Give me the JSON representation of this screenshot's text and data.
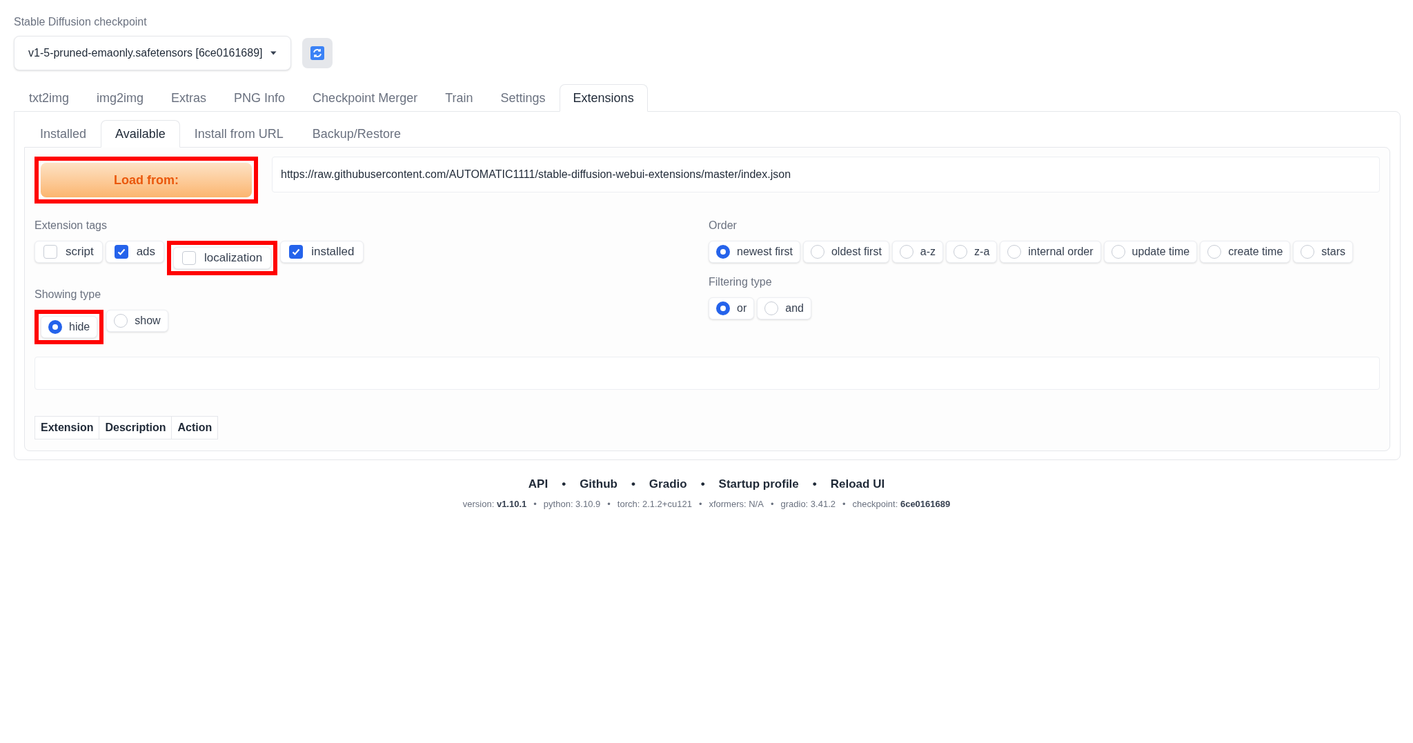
{
  "checkpoint": {
    "label": "Stable Diffusion checkpoint",
    "value": "v1-5-pruned-emaonly.safetensors [6ce0161689]"
  },
  "tabs": [
    {
      "label": "txt2img",
      "selected": false
    },
    {
      "label": "img2img",
      "selected": false
    },
    {
      "label": "Extras",
      "selected": false
    },
    {
      "label": "PNG Info",
      "selected": false
    },
    {
      "label": "Checkpoint Merger",
      "selected": false
    },
    {
      "label": "Train",
      "selected": false
    },
    {
      "label": "Settings",
      "selected": false
    },
    {
      "label": "Extensions",
      "selected": true
    }
  ],
  "subtabs": [
    {
      "label": "Installed",
      "selected": false
    },
    {
      "label": "Available",
      "selected": true
    },
    {
      "label": "Install from URL",
      "selected": false
    },
    {
      "label": "Backup/Restore",
      "selected": false
    }
  ],
  "load_button": {
    "label": "Load from:",
    "highlighted": true
  },
  "url_field": {
    "value": "https://raw.githubusercontent.com/AUTOMATIC1111/stable-diffusion-webui-extensions/master/index.json"
  },
  "extension_tags": {
    "label": "Extension tags",
    "items": [
      {
        "label": "script",
        "checked": false,
        "highlighted": false
      },
      {
        "label": "ads",
        "checked": true,
        "highlighted": false
      },
      {
        "label": "localization",
        "checked": false,
        "highlighted": true
      },
      {
        "label": "installed",
        "checked": true,
        "highlighted": false
      }
    ]
  },
  "order": {
    "label": "Order",
    "items": [
      {
        "label": "newest first",
        "selected": true
      },
      {
        "label": "oldest first",
        "selected": false
      },
      {
        "label": "a-z",
        "selected": false
      },
      {
        "label": "z-a",
        "selected": false
      },
      {
        "label": "internal order",
        "selected": false
      },
      {
        "label": "update time",
        "selected": false
      },
      {
        "label": "create time",
        "selected": false
      },
      {
        "label": "stars",
        "selected": false
      }
    ]
  },
  "showing_type": {
    "label": "Showing type",
    "items": [
      {
        "label": "hide",
        "selected": true,
        "highlighted": true
      },
      {
        "label": "show",
        "selected": false,
        "highlighted": false
      }
    ]
  },
  "filtering_type": {
    "label": "Filtering type",
    "items": [
      {
        "label": "or",
        "selected": true
      },
      {
        "label": "and",
        "selected": false
      }
    ]
  },
  "table": {
    "columns": [
      "Extension",
      "Description",
      "Action"
    ]
  },
  "footer": {
    "links": [
      "API",
      "Github",
      "Gradio",
      "Startup profile",
      "Reload UI"
    ],
    "separator": "•",
    "versions": [
      "version: **v1.10.1**",
      "python: 3.10.9",
      "torch: 2.1.2+cu121",
      "xformers: N/A",
      "gradio: 3.41.2",
      "checkpoint: **6ce0161689**"
    ]
  }
}
